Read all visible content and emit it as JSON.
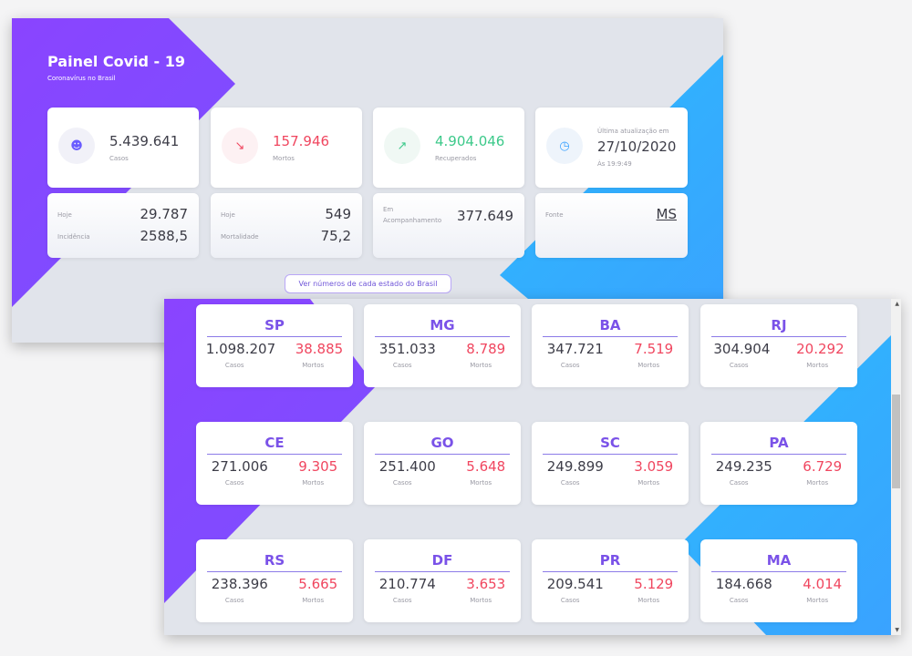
{
  "header": {
    "title": "Painel Covid - 19",
    "subtitle": "Coronavírus no Brasil"
  },
  "summary": {
    "cases": {
      "value": "5.439.641",
      "label": "Casos",
      "icon": "user-icon"
    },
    "deaths": {
      "value": "157.946",
      "label": "Mortos",
      "icon": "trend-down-icon"
    },
    "recovered": {
      "value": "4.904.046",
      "label": "Recuperados",
      "icon": "trend-up-icon"
    },
    "update": {
      "label": "Última atualização em",
      "date": "27/10/2020",
      "time": "Às 19:9:49",
      "icon": "clock-icon"
    }
  },
  "details": {
    "cases_today_label": "Hoje",
    "cases_today": "29.787",
    "incidence_label": "Incidência",
    "incidence": "2588,5",
    "deaths_today_label": "Hoje",
    "deaths_today": "549",
    "mortality_label": "Mortalidade",
    "mortality": "75,2",
    "monitoring_label": "Em Acompanhamento",
    "monitoring": "377.649",
    "source_label": "Fonte",
    "source": "MS"
  },
  "states_button": "Ver números de cada estado do Brasil",
  "states_labels": {
    "cases": "Casos",
    "deaths": "Mortos"
  },
  "states": [
    {
      "uf": "SP",
      "cases": "1.098.207",
      "deaths": "38.885"
    },
    {
      "uf": "MG",
      "cases": "351.033",
      "deaths": "8.789"
    },
    {
      "uf": "BA",
      "cases": "347.721",
      "deaths": "7.519"
    },
    {
      "uf": "RJ",
      "cases": "304.904",
      "deaths": "20.292"
    },
    {
      "uf": "CE",
      "cases": "271.006",
      "deaths": "9.305"
    },
    {
      "uf": "GO",
      "cases": "251.400",
      "deaths": "5.648"
    },
    {
      "uf": "SC",
      "cases": "249.899",
      "deaths": "3.059"
    },
    {
      "uf": "PA",
      "cases": "249.235",
      "deaths": "6.729"
    },
    {
      "uf": "RS",
      "cases": "238.396",
      "deaths": "5.665"
    },
    {
      "uf": "DF",
      "cases": "210.774",
      "deaths": "3.653"
    },
    {
      "uf": "PR",
      "cases": "209.541",
      "deaths": "5.129"
    },
    {
      "uf": "MA",
      "cases": "184.668",
      "deaths": "4.014"
    }
  ],
  "colors": {
    "deaths": "#f0465f",
    "recovered": "#3cc98a",
    "accent": "#7a52e8",
    "clock": "#3aa2ff"
  }
}
